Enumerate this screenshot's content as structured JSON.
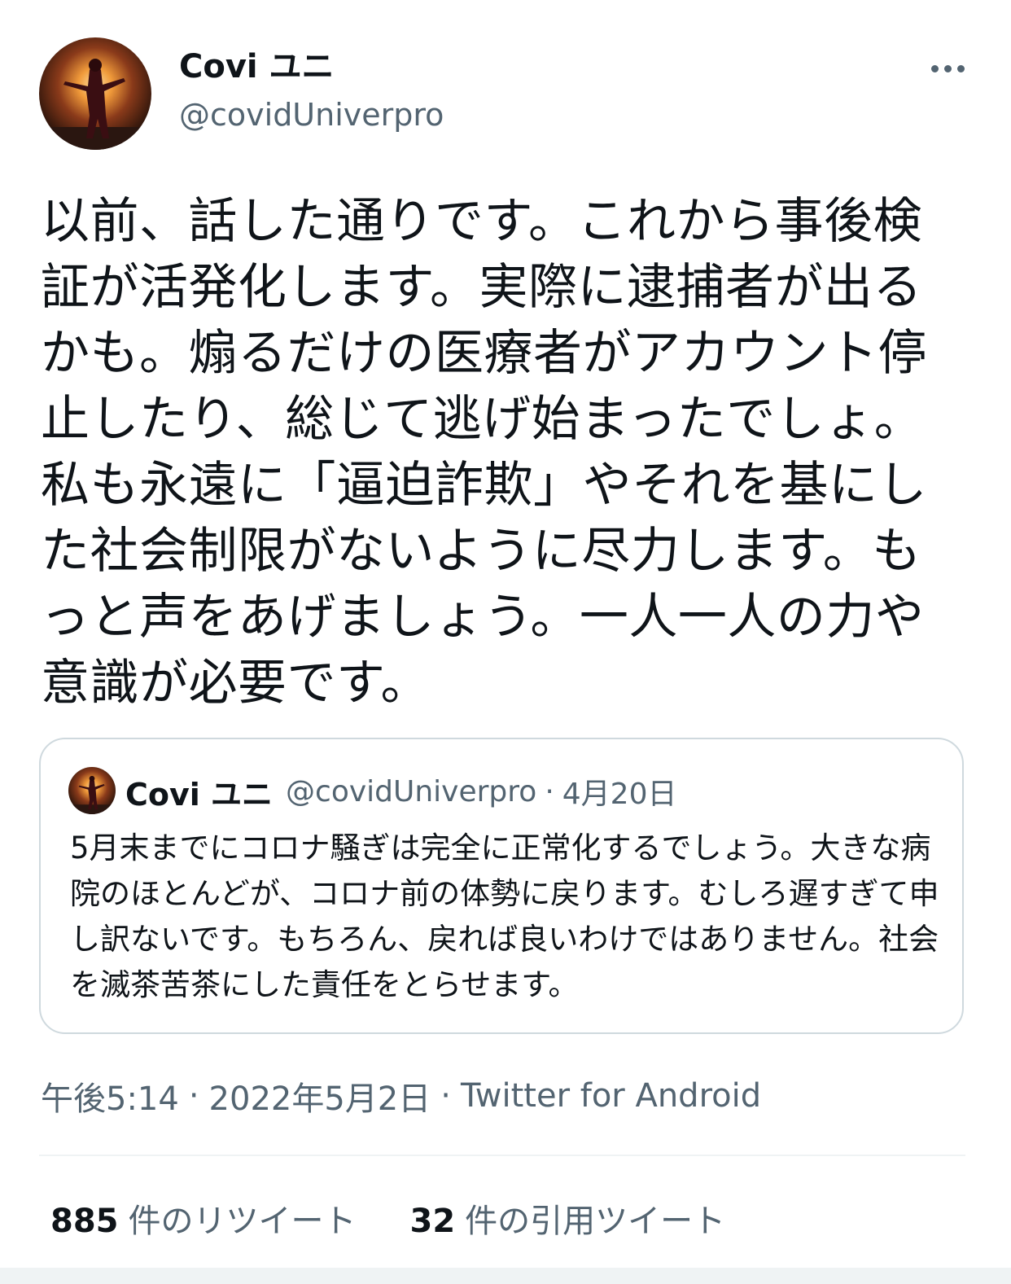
{
  "author": {
    "display_name": "Covi ユニ",
    "handle": "@covidUniverpro"
  },
  "tweet": {
    "text": "以前、話した通りです。これから事後検証が活発化します。実際に逮捕者が出るかも。煽るだけの医療者がアカウント停止したり、総じて逃げ始まったでしょ。私も永遠に「逼迫詐欺」やそれを基にした社会制限がないように尽力します。もっと声をあげましょう。一人一人の力や意識が必要です。"
  },
  "quoted_tweet": {
    "display_name": "Covi ユニ",
    "handle": "@covidUniverpro",
    "separator": "·",
    "date": "4月20日",
    "text": "5月末までにコロナ騒ぎは完全に正常化するでしょう。大きな病院のほとんどが、コロナ前の体勢に戻ります。むしろ遅すぎて申し訳ないです。もちろん、戻れば良いわけではありません。社会を滅茶苦茶にした責任をとらせます。"
  },
  "meta": {
    "time": "午後5:14",
    "separator": "·",
    "date": "2022年5月2日",
    "source": "Twitter for Android"
  },
  "stats": {
    "retweets_count": "885",
    "retweets_label": "件のリツイート",
    "quotes_count": "32",
    "quotes_label": "件の引用ツイート"
  },
  "icons": {
    "more": "more-horizontal-icon"
  },
  "colors": {
    "text_primary": "#0f1419",
    "text_secondary": "#536471",
    "border": "#cfd9de",
    "divider": "#eff3f4",
    "background": "#ffffff"
  }
}
